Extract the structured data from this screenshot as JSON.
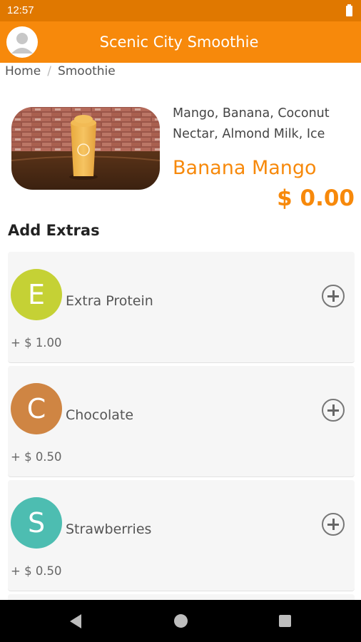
{
  "status_bar": {
    "time": "12:57"
  },
  "app_bar": {
    "title": "Scenic City Smoothie",
    "avatar_icon": "user-avatar-icon"
  },
  "breadcrumb": {
    "items": [
      "Home",
      "Smoothie"
    ],
    "separator": "/"
  },
  "product": {
    "ingredients": "Mango, Banana, Coconut Nectar, Almond Milk, Ice",
    "name": "Banana Mango",
    "price": "$ 0.00"
  },
  "extras": {
    "title": "Add Extras",
    "items": [
      {
        "letter": "E",
        "name": "Extra Protein",
        "price": "+ $ 1.00",
        "color": "#c5d135"
      },
      {
        "letter": "C",
        "name": "Chocolate",
        "price": "+ $ 0.50",
        "color": "#cf8543"
      },
      {
        "letter": "S",
        "name": "Strawberries",
        "price": "+ $ 0.50",
        "color": "#4dbdb1"
      }
    ]
  },
  "colors": {
    "accent": "#f7890b",
    "status_bar": "#e07800"
  },
  "nav": {
    "icons": [
      "back-icon",
      "home-icon",
      "recents-icon"
    ]
  }
}
